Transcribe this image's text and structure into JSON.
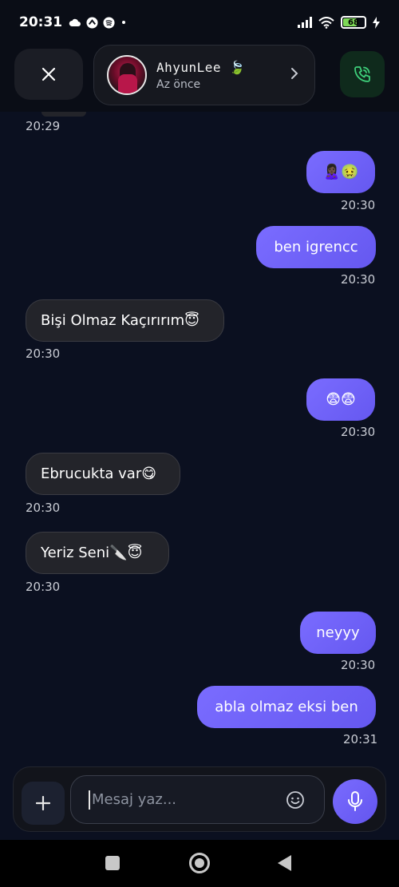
{
  "status_bar": {
    "time": "20:31",
    "left_icons": [
      "cloud-icon",
      "phone-app-icon",
      "spotify-icon",
      "dot-icon"
    ],
    "battery_level": "68"
  },
  "header": {
    "contact_name": "AhyunLee 🍃",
    "contact_status": "Az önce"
  },
  "messages": [
    {
      "direction": "in",
      "text": "",
      "time": "20:29"
    },
    {
      "direction": "out",
      "text": "🙎🏿‍♀️🤢",
      "time": "20:30"
    },
    {
      "direction": "out",
      "text": "ben igrencc",
      "time": "20:30"
    },
    {
      "direction": "in",
      "text": "Bişi Olmaz Kaçırırım😇",
      "time": "20:30"
    },
    {
      "direction": "out",
      "text": "😨😨",
      "time": "20:30"
    },
    {
      "direction": "in",
      "text": "Ebrucukta var😋",
      "time": "20:30"
    },
    {
      "direction": "in",
      "text": "Yeriz Seni🔪😇",
      "time": "20:30"
    },
    {
      "direction": "out",
      "text": "neyyy",
      "time": "20:30"
    },
    {
      "direction": "out",
      "text": "abla olmaz eksi ben",
      "time": "20:31"
    }
  ],
  "composer": {
    "placeholder": "Mesaj yaz..."
  },
  "colors": {
    "background": "#0b1020",
    "outgoing_bubble": "#6f62f7",
    "incoming_bubble": "#23242a",
    "call_accent": "#3ecf7a"
  }
}
